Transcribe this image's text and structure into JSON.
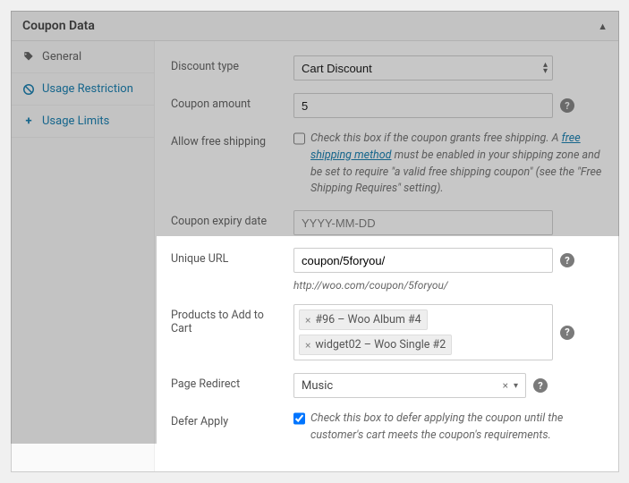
{
  "panel": {
    "title": "Coupon Data"
  },
  "tabs": {
    "general": "General",
    "restriction": "Usage Restriction",
    "limits": "Usage Limits"
  },
  "fields": {
    "discount_type": {
      "label": "Discount type",
      "value": "Cart Discount"
    },
    "coupon_amount": {
      "label": "Coupon amount",
      "value": "5"
    },
    "free_shipping": {
      "label": "Allow free shipping",
      "desc_pre": "Check this box if the coupon grants free shipping. A ",
      "link": "free shipping method",
      "desc_post": " must be enabled in your shipping zone and be set to require \"a valid free shipping coupon\" (see the \"Free Shipping Requires\" setting)."
    },
    "expiry": {
      "label": "Coupon expiry date",
      "placeholder": "YYYY-MM-DD"
    },
    "unique_url": {
      "label": "Unique URL",
      "value": "coupon/5foryou/",
      "hint": "http://woo.com/coupon/5foryou/"
    },
    "products_add": {
      "label": "Products to Add to Cart",
      "items": [
        "#96 – Woo Album #4",
        "widget02 – Woo Single #2"
      ]
    },
    "page_redirect": {
      "label": "Page Redirect",
      "value": "Music"
    },
    "defer_apply": {
      "label": "Defer Apply",
      "desc": "Check this box to defer applying the coupon until the customer's cart meets the coupon's requirements."
    }
  }
}
